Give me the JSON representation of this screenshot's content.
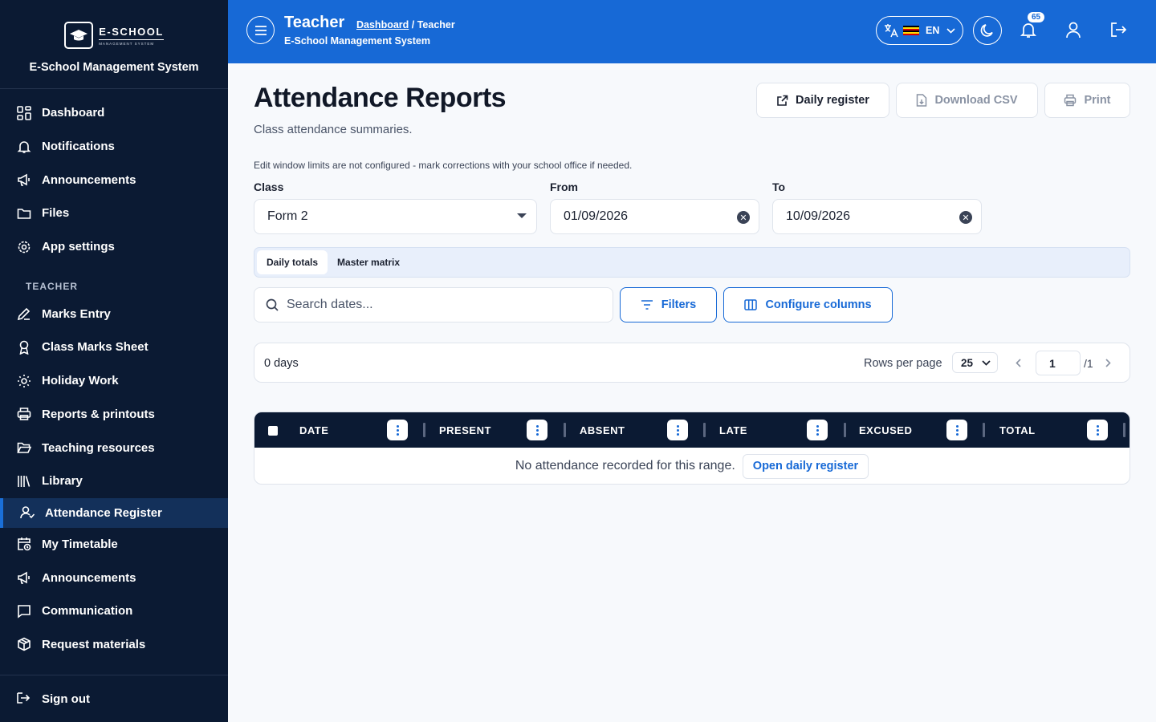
{
  "brand": {
    "logo_line1": "E-SCHOOL",
    "logo_line2": "MANAGEMENT SYSTEM",
    "name": "E-School Management System"
  },
  "sidebar": {
    "items_top": [
      {
        "label": "Dashboard",
        "icon": "grid-icon"
      },
      {
        "label": "Notifications",
        "icon": "bell-icon"
      },
      {
        "label": "Announcements",
        "icon": "megaphone-icon"
      },
      {
        "label": "Files",
        "icon": "folder-icon"
      },
      {
        "label": "App settings",
        "icon": "gear-icon"
      }
    ],
    "section_label": "TEACHER",
    "items_teacher": [
      {
        "label": "Marks Entry",
        "icon": "pen-icon"
      },
      {
        "label": "Class Marks Sheet",
        "icon": "award-icon"
      },
      {
        "label": "Holiday Work",
        "icon": "sun-icon"
      },
      {
        "label": "Reports & printouts",
        "icon": "printer-icon"
      },
      {
        "label": "Teaching resources",
        "icon": "folder-open-icon"
      },
      {
        "label": "Library",
        "icon": "library-icon"
      },
      {
        "label": "Attendance Register",
        "icon": "user-check-icon",
        "active": true
      },
      {
        "label": "My Timetable",
        "icon": "calendar-clock-icon"
      },
      {
        "label": "Announcements",
        "icon": "megaphone-icon"
      },
      {
        "label": "Communication",
        "icon": "message-icon"
      },
      {
        "label": "Request materials",
        "icon": "box-icon"
      }
    ],
    "signout": "Sign out"
  },
  "header": {
    "title": "Teacher",
    "breadcrumb_link": "Dashboard",
    "breadcrumb_sep": " / ",
    "breadcrumb_current": "Teacher",
    "subtitle": "E-School Management System",
    "lang_code": "EN",
    "notification_count": "65",
    "accent": "#1769d6"
  },
  "page": {
    "title": "Attendance Reports",
    "subtitle": "Class attendance summaries.",
    "actions": {
      "daily_register": "Daily register",
      "download_csv": "Download CSV",
      "print": "Print"
    },
    "notice": "Edit window limits are not configured - mark corrections with your school office if needed.",
    "filters": {
      "class_label": "Class",
      "class_value": "Form 2",
      "from_label": "From",
      "from_value": "01/09/2026",
      "to_label": "To",
      "to_value": "10/09/2026"
    },
    "tabs": [
      "Daily totals",
      "Master matrix"
    ],
    "search_placeholder": "Search dates...",
    "filters_btn": "Filters",
    "configure_btn": "Configure columns",
    "pager": {
      "count": "0 days",
      "rows_label": "Rows per page",
      "rows_value": "25",
      "page": "1",
      "total": "/1"
    },
    "table": {
      "columns": [
        "DATE",
        "PRESENT",
        "ABSENT",
        "LATE",
        "EXCUSED",
        "TOTAL"
      ],
      "empty_text": "No attendance recorded for this range.",
      "empty_link": "Open daily register"
    }
  }
}
